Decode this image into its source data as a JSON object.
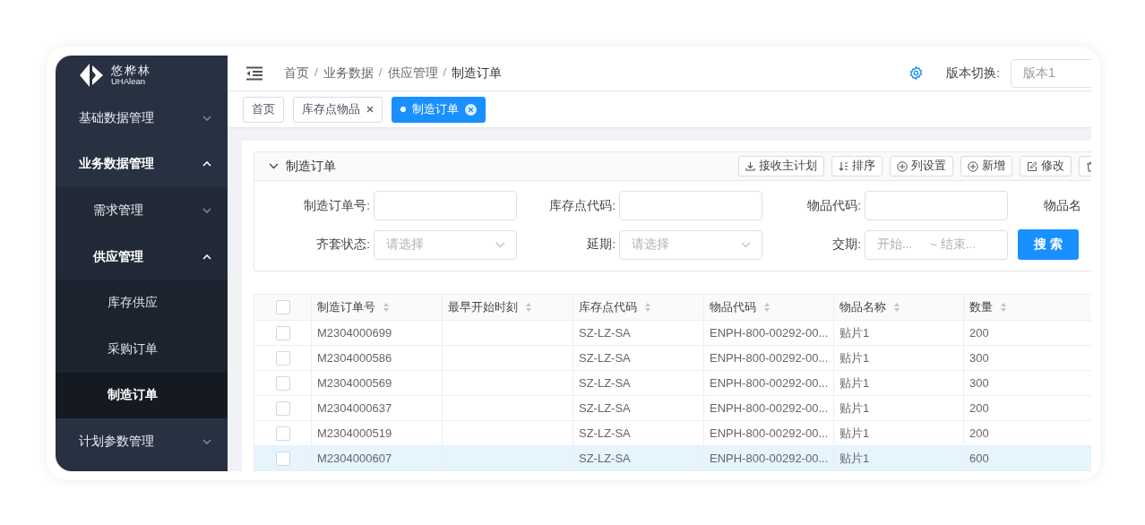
{
  "logo": {
    "name": "悠桦林",
    "subtitle": "UHAlean"
  },
  "sidebar": {
    "items": [
      {
        "label": "基础数据管理",
        "expanded": false
      },
      {
        "label": "业务数据管理",
        "expanded": true,
        "children": [
          {
            "label": "需求管理",
            "expanded": false
          },
          {
            "label": "供应管理",
            "expanded": true,
            "children": [
              {
                "label": "库存供应",
                "selected": false
              },
              {
                "label": "采购订单",
                "selected": false
              },
              {
                "label": "制造订单",
                "selected": true
              }
            ]
          }
        ]
      },
      {
        "label": "计划参数管理",
        "expanded": false
      }
    ]
  },
  "breadcrumb": [
    {
      "label": "首页"
    },
    {
      "separator": "/",
      "label": "业务数据"
    },
    {
      "separator": "/",
      "label": "供应管理"
    },
    {
      "separator": "/",
      "label": "制造订单"
    }
  ],
  "version": {
    "label": "版本切换:",
    "value": "版本1"
  },
  "tabs": [
    {
      "label": "首页",
      "selected": false,
      "closable": false
    },
    {
      "label": "库存点物品",
      "selected": false,
      "closable": true
    },
    {
      "label": "制造订单",
      "selected": true,
      "closable": true
    }
  ],
  "panel": {
    "title": "制造订单",
    "expanded": true,
    "actions": [
      {
        "kind": "download",
        "label": "接收主计划"
      },
      {
        "kind": "sort",
        "label": "排序"
      },
      {
        "kind": "plus",
        "label": "列设置"
      },
      {
        "kind": "plus",
        "label": "新增"
      },
      {
        "kind": "edit",
        "label": "修改"
      },
      {
        "kind": "trash"
      }
    ],
    "filters": [
      {
        "kind": "input",
        "label": "制造订单号:"
      },
      {
        "kind": "input",
        "label": "库存点代码:"
      },
      {
        "kind": "input",
        "label": "物品代码:"
      },
      {
        "kind": "label",
        "label": "物品名"
      },
      {
        "kind": "select",
        "label": "齐套状态:",
        "placeholder": "请选择"
      },
      {
        "kind": "select",
        "label": "延期:",
        "placeholder": "请选择"
      },
      {
        "kind": "range",
        "label": "交期:",
        "placeholder": "开始...",
        "placeholder_end": "~ 结束..."
      },
      {
        "kind": "button",
        "label": "搜 索"
      }
    ]
  },
  "table": {
    "all_checked": false,
    "columns": [
      "制造订单号",
      "最早开始时刻",
      "库存点代码",
      "物品代码",
      "物品名称",
      "数量"
    ],
    "rows": [
      {
        "checked": false,
        "selected": false,
        "cells": [
          "M2304000699",
          null,
          "SZ-LZ-SA",
          "ENPH-800-00292-00...",
          "贴片1",
          "200"
        ]
      },
      {
        "checked": false,
        "selected": false,
        "cells": [
          "M2304000586",
          null,
          "SZ-LZ-SA",
          "ENPH-800-00292-00...",
          "贴片1",
          "300"
        ]
      },
      {
        "checked": false,
        "selected": false,
        "cells": [
          "M2304000569",
          null,
          "SZ-LZ-SA",
          "ENPH-800-00292-00...",
          "贴片1",
          "300"
        ]
      },
      {
        "checked": false,
        "selected": false,
        "cells": [
          "M2304000637",
          null,
          "SZ-LZ-SA",
          "ENPH-800-00292-00...",
          "贴片1",
          "200"
        ]
      },
      {
        "checked": false,
        "selected": false,
        "cells": [
          "M2304000519",
          null,
          "SZ-LZ-SA",
          "ENPH-800-00292-00...",
          "贴片1",
          "200"
        ]
      },
      {
        "checked": false,
        "selected": true,
        "cells": [
          "M2304000607",
          null,
          "SZ-LZ-SA",
          "ENPH-800-00292-00...",
          "贴片1",
          "600"
        ]
      }
    ]
  }
}
